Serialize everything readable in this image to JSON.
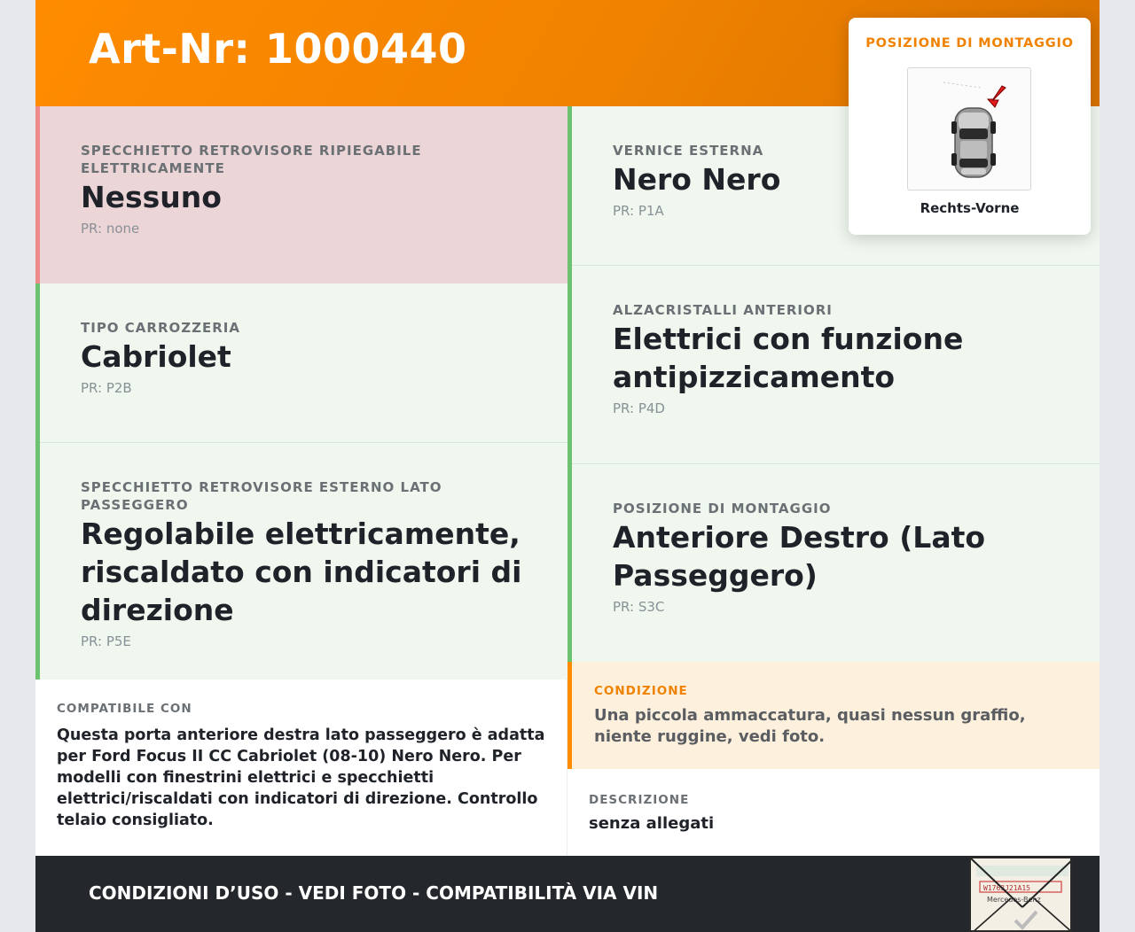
{
  "header": {
    "title": "Art-Nr: 1000440"
  },
  "left_cells": [
    {
      "label": "SPECCHIETTO RETROVISORE RIPIEGABILE ELETTRICAMENTE",
      "value": "Nessuno",
      "pr": "PR: none",
      "status": "red"
    },
    {
      "label": "TIPO CARROZZERIA",
      "value": "Cabriolet",
      "pr": "PR: P2B",
      "status": "green"
    },
    {
      "label": "SPECCHIETTO RETROVISORE ESTERNO LATO PASSEGGERO",
      "value": "Regolabile elettricamente, riscaldato con indicatori di direzione",
      "pr": "PR: P5E",
      "status": "green"
    }
  ],
  "right_cells": [
    {
      "label": "VERNICE ESTERNA",
      "value": "Nero Nero",
      "pr": "PR: P1A",
      "status": "green"
    },
    {
      "label": "ALZACRISTALLI ANTERIORI",
      "value": "Elettrici con funzione antipizzicamento",
      "pr": "PR: P4D",
      "status": "green"
    },
    {
      "label": "POSIZIONE DI MONTAGGIO",
      "value": "Anteriore Destro (Lato Passeggero)",
      "pr": "PR: S3C",
      "status": "green"
    }
  ],
  "compat": {
    "label": "COMPATIBILE CON",
    "text": "Questa porta anteriore destra lato passeggero è adatta per Ford Focus II CC Cabriolet (08-10) Nero Nero. Per modelli con finestrini elettrici e specchietti elettrici/riscaldati con indicatori di direzione. Controllo telaio consigliato."
  },
  "condition": {
    "label": "CONDIZIONE",
    "text": "Una piccola ammaccatura, quasi nessun graffio, niente ruggine, vedi foto."
  },
  "description": {
    "label": "DESCRIZIONE",
    "text": "senza allegati"
  },
  "footer": {
    "text": "CONDIZIONI D’USO - VEDI FOTO - COMPATIBILITÀ VIA VIN",
    "stamp_text": "Mercedes-Benz"
  },
  "mount_popup": {
    "title": "POSIZIONE DI MONTAGGIO",
    "caption": "Rechts-Vorne"
  },
  "colors": {
    "brand_orange": "#ff8c00",
    "ok_green": "#6cc36f",
    "warn_red": "#ef8a8a",
    "dark_footer": "#24272b"
  }
}
